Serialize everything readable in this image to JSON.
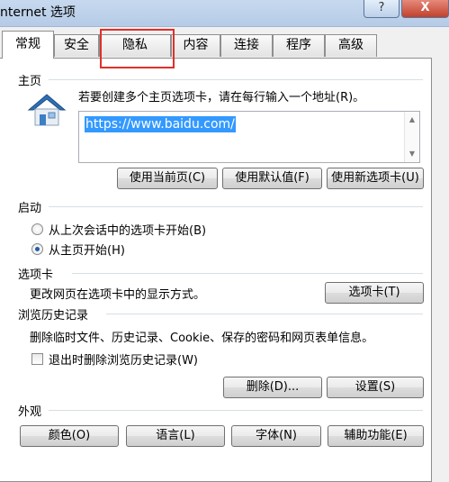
{
  "window": {
    "title": "nternet 选项",
    "help": "?",
    "close": "X"
  },
  "tabs": [
    "常规",
    "安全",
    "隐私",
    "内容",
    "连接",
    "程序",
    "高级"
  ],
  "home": {
    "group_label": "主页",
    "instruction": "若要创建多个主页选项卡，请在每行输入一个地址(R)。",
    "url": "https://www.baidu.com/",
    "btn_current": "使用当前页(C)",
    "btn_default": "使用默认值(F)",
    "btn_newtab": "使用新选项卡(U)"
  },
  "startup": {
    "group_label": "启动",
    "option_last": "从上次会话中的选项卡开始(B)",
    "option_home": "从主页开始(H)"
  },
  "tabs_group": {
    "group_label": "选项卡",
    "desc": "更改网页在选项卡中的显示方式。",
    "btn": "选项卡(T)"
  },
  "history": {
    "group_label": "浏览历史记录",
    "desc": "删除临时文件、历史记录、Cookie、保存的密码和网页表单信息。",
    "checkbox": "退出时删除浏览历史记录(W)",
    "btn_delete": "删除(D)...",
    "btn_settings": "设置(S)"
  },
  "appearance": {
    "group_label": "外观",
    "btn_colors": "颜色(O)",
    "btn_languages": "语言(L)",
    "btn_fonts": "字体(N)",
    "btn_accessibility": "辅助功能(E)"
  },
  "colors": {
    "highlight": "#e0302a",
    "selection": "#3399ff"
  }
}
